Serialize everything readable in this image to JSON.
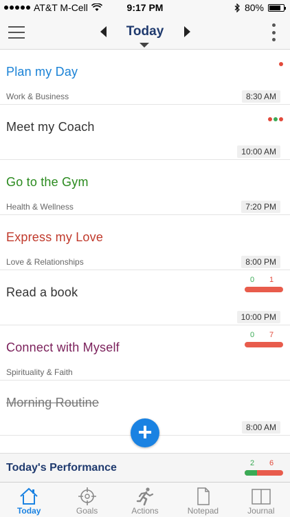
{
  "status_bar": {
    "carrier": "AT&T M-Cell",
    "time": "9:17 PM",
    "battery": "80%"
  },
  "nav": {
    "title": "Today"
  },
  "items": [
    {
      "title": "Plan my Day",
      "category": "Work & Business",
      "time": "8:30 AM",
      "color": "#1a82d6",
      "dots": [
        "#e24a3b"
      ]
    },
    {
      "title": "Meet my Coach",
      "category": "",
      "time": "10:00 AM",
      "color": "#333333",
      "dots": [
        "#e24a3b",
        "#3aaa55",
        "#e24a3b"
      ]
    },
    {
      "title": "Go to the Gym",
      "category": "Health & Wellness",
      "time": "7:20 PM",
      "color": "#2a8a1e"
    },
    {
      "title": "Express my Love",
      "category": "Love & Relationships",
      "time": "8:00 PM",
      "color": "#c0392b"
    },
    {
      "title": "Read a book",
      "category": "",
      "time": "10:00 PM",
      "color": "#333333",
      "progress": {
        "done": "0",
        "total": "1",
        "fraction": 0
      }
    },
    {
      "title": "Connect with Myself",
      "category": "Spirituality & Faith",
      "time": "",
      "color": "#7a1f5a",
      "progress": {
        "done": "0",
        "total": "7",
        "fraction": 0
      }
    },
    {
      "title": "Morning Routine",
      "category": "",
      "time": "8:00 AM",
      "color": "#777777",
      "completed": true
    }
  ],
  "fab": {
    "symbol": "+"
  },
  "performance": {
    "label": "Today's Performance",
    "done": "2",
    "total": "6",
    "fraction": 0.33
  },
  "tabs": [
    {
      "label": "Today",
      "icon": "home-icon",
      "active": true
    },
    {
      "label": "Goals",
      "icon": "crosshair-icon"
    },
    {
      "label": "Actions",
      "icon": "runner-icon"
    },
    {
      "label": "Notepad",
      "icon": "note-icon"
    },
    {
      "label": "Journal",
      "icon": "book-icon"
    }
  ],
  "colors": {
    "accent": "#1a82e2",
    "done": "#3aaa55",
    "remaining": "#e85c4c",
    "nav_title": "#1f3a6e"
  }
}
